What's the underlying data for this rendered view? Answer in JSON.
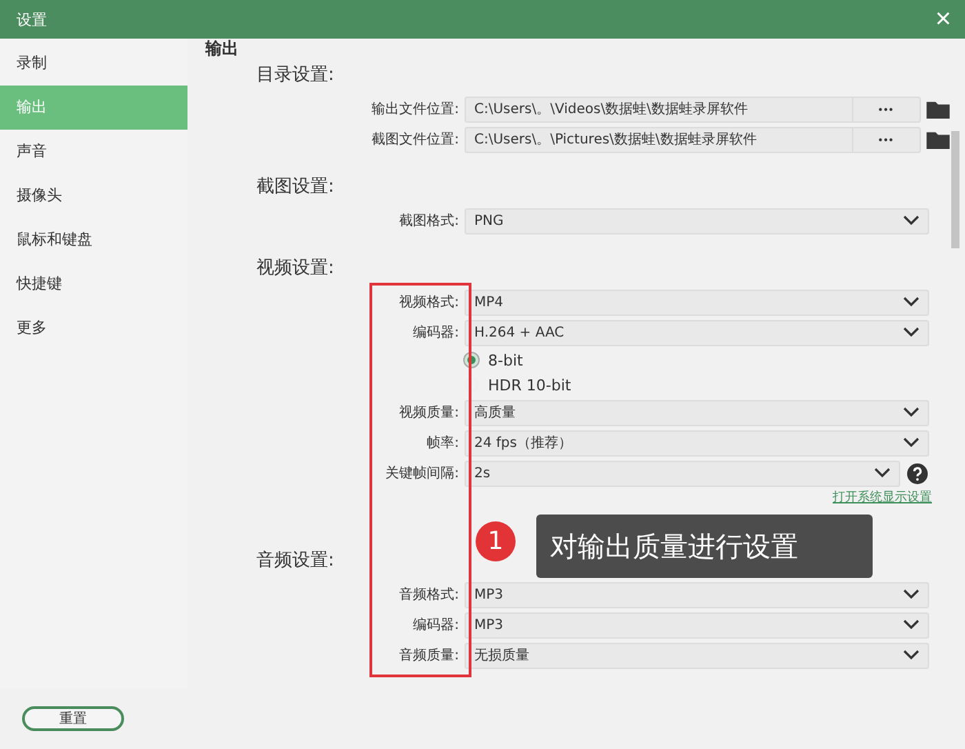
{
  "window": {
    "title": "设置",
    "close": "×"
  },
  "sidebar": {
    "items": [
      {
        "label": "录制",
        "selected": false
      },
      {
        "label": "输出",
        "selected": true
      },
      {
        "label": "声音",
        "selected": false
      },
      {
        "label": "摄像头",
        "selected": false
      },
      {
        "label": "鼠标和键盘",
        "selected": false
      },
      {
        "label": "快捷键",
        "selected": false
      },
      {
        "label": "更多",
        "selected": false
      }
    ]
  },
  "content": {
    "heading": "输出",
    "sections": [
      {
        "title": "目录设置:",
        "rows": [
          {
            "kind": "path",
            "label": "输出文件位置:",
            "value": "C:\\Users\\。\\Videos\\数据蛙\\数据蛙录屏软件",
            "button": "•••"
          },
          {
            "kind": "path",
            "label": "截图文件位置:",
            "value": "C:\\Users\\。\\Pictures\\数据蛙\\数据蛙录屏软件",
            "button": "•••"
          }
        ]
      },
      {
        "title": "截图设置:",
        "rows": [
          {
            "kind": "select",
            "label": "截图格式:",
            "value": "PNG"
          }
        ]
      },
      {
        "title": "视频设置:",
        "rows": [
          {
            "kind": "select",
            "label": "视频格式:",
            "value": "MP4"
          },
          {
            "kind": "select",
            "label": "编码器:",
            "value": "H.264 + AAC"
          },
          {
            "kind": "radio",
            "label": "8-bit",
            "selected": true
          },
          {
            "kind": "radio",
            "label": "HDR 10-bit",
            "selected": false
          },
          {
            "kind": "select",
            "label": "视频质量:",
            "value": "高质量"
          },
          {
            "kind": "select",
            "label": "帧率:",
            "value": "24 fps（推荐）"
          },
          {
            "kind": "select",
            "label": "关键帧间隔:",
            "value": "2s",
            "help": true
          },
          {
            "kind": "link",
            "label": "打开系统显示设置"
          }
        ]
      },
      {
        "title": "音频设置:",
        "rows": [
          {
            "kind": "select",
            "label": "音频格式:",
            "value": "MP3"
          },
          {
            "kind": "select",
            "label": "编码器:",
            "value": "MP3"
          },
          {
            "kind": "select",
            "label": "音频质量:",
            "value": "无损质量"
          }
        ]
      }
    ]
  },
  "reset_button": "重置",
  "annotation": {
    "number": "1",
    "text": "对输出质量进行设置"
  }
}
